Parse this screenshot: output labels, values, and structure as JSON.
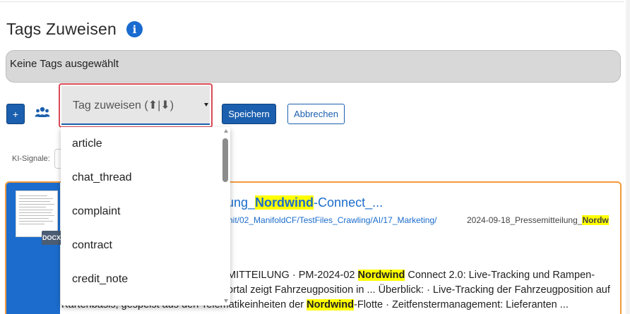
{
  "header": {
    "title": "Tags Zuweisen",
    "info_icon": "info-icon"
  },
  "tags_box": {
    "value": "Keine Tags ausgewählt"
  },
  "toolbar": {
    "add_label": "+",
    "group_icon": "people-icon",
    "select_placeholder": "Tag zuweisen (⬆|⬇)",
    "save_label": "Speichern",
    "cancel_label": "Abbrechen"
  },
  "ki_signals": {
    "label": "KI-Signale:"
  },
  "dropdown": {
    "options": [
      "article",
      "chat_thread",
      "complaint",
      "contract",
      "credit_note"
    ]
  },
  "result": {
    "file_type": "DOCX",
    "title_pre": "lung_",
    "title_hl": "Nordwind",
    "title_post": "-Connect_...",
    "path": "chit/02_ManifoldCF/TestFiles_Crawling/AI/17_Marketing/",
    "file_pre": "2024-09-18_Pressemitteilung_",
    "file_hl": "Nordw",
    "snippet_1_pre": "MITTEILUNG · PM-2024-02 ",
    "snippet_1_hl": "Nordwind",
    "snippet_1_post": " Connect 2.0: Live-Tracking und Rampen-",
    "snippet_2": "ortal zeigt Fahrzeugposition in ... Überblick: · Live-Tracking der Fahrzeugposition auf",
    "snippet_3_pre": "Kartenbasis, gespeist aus den Telematikeinheiten der ",
    "snippet_3_hl": "Nordwind",
    "snippet_3_post": "-Flotte · Zeitfenstermanagement: Lieferanten ..."
  },
  "colors": {
    "primary": "#1b5fae",
    "card_border": "#f29a3c",
    "focus_border": "#d84a55",
    "highlight": "#ffff00"
  }
}
